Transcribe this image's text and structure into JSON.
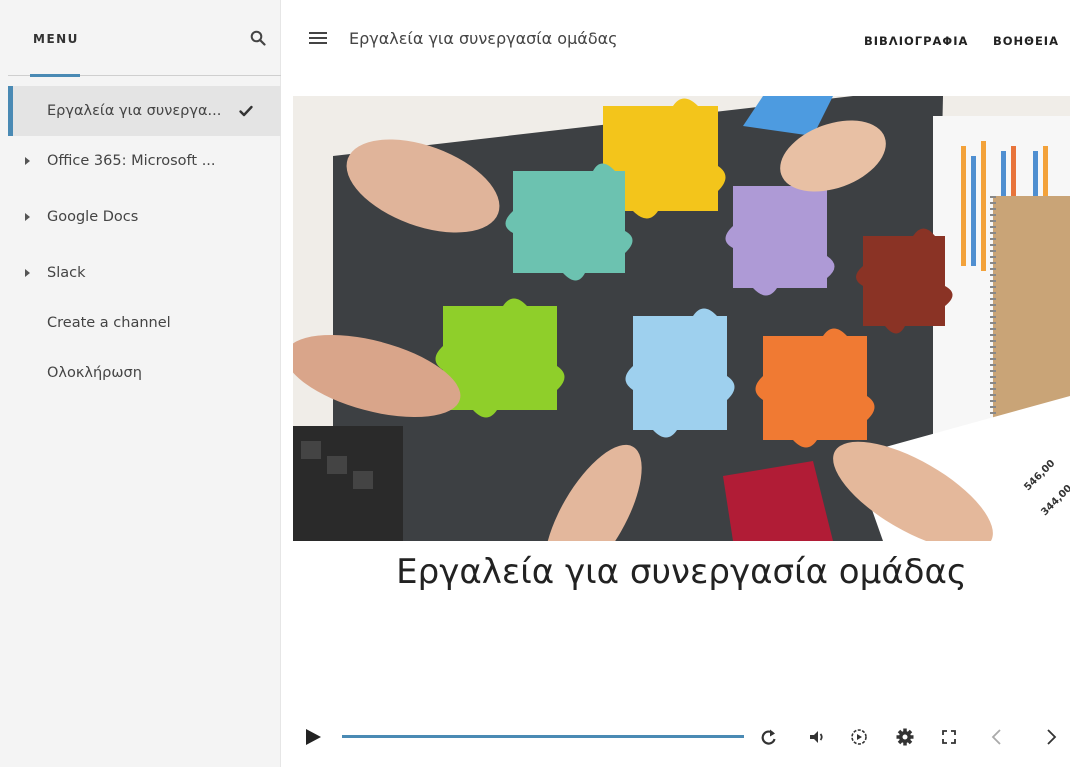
{
  "sidebar": {
    "menu_label": "MENU",
    "search_icon": "search-icon",
    "items": [
      {
        "label": "Εργαλεία για συνεργα...",
        "active": true,
        "expandable": false,
        "completed": true
      },
      {
        "label": "Office 365: Microsoft ...",
        "active": false,
        "expandable": true
      },
      {
        "label": "Google Docs",
        "active": false,
        "expandable": true
      },
      {
        "label": "Slack",
        "active": false,
        "expandable": true
      },
      {
        "label": "Create a channel",
        "active": false,
        "expandable": false
      },
      {
        "label": "Ολοκλήρωση",
        "active": false,
        "expandable": false
      }
    ]
  },
  "header": {
    "title": "Εργαλεία για συνεργασία ομάδας",
    "links": [
      "ΒΙΒΛΙΟΓΡΑΦΙΑ",
      "ΒΟΗΘΕΙΑ"
    ]
  },
  "slide": {
    "title": "Εργαλεία για συνεργασία ομάδας",
    "image_numbers": [
      "546,00",
      "344,00"
    ]
  },
  "player": {
    "progress": 1.0,
    "controls": [
      "play-icon",
      "replay-icon",
      "volume-icon",
      "playback-speed-icon",
      "settings-icon",
      "fullscreen-icon",
      "previous-icon",
      "next-icon"
    ]
  },
  "colors": {
    "accent": "#4a8ab4",
    "sidebar_bg": "#f4f4f4",
    "active_item_bg": "#e4e4e4"
  }
}
